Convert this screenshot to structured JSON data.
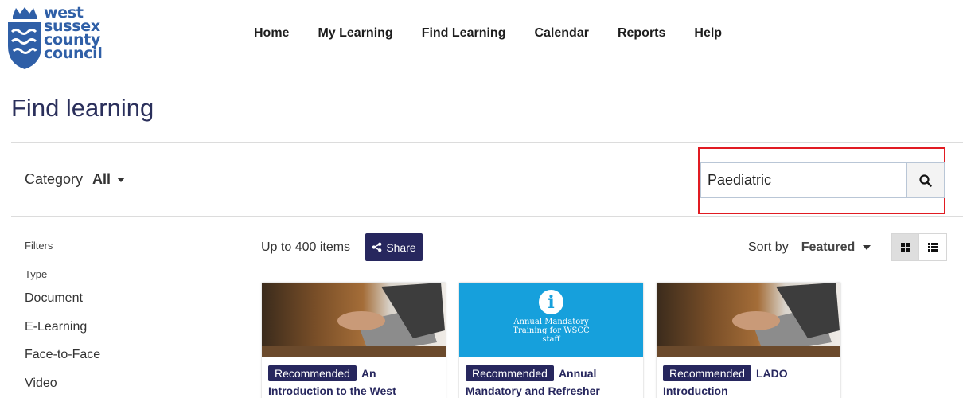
{
  "brand": {
    "logo_lines": [
      "west",
      "sussex",
      "county",
      "council"
    ],
    "color": "#2f5fa7"
  },
  "nav": {
    "items": [
      "Home",
      "My Learning",
      "Find Learning",
      "Calendar",
      "Reports",
      "Help"
    ]
  },
  "page": {
    "title": "Find learning"
  },
  "category": {
    "label": "Category",
    "value": "All"
  },
  "search": {
    "value": "Paediatric",
    "highlight_color": "#e11b22"
  },
  "filters": {
    "heading": "Filters",
    "type_heading": "Type",
    "type_items": [
      "Document",
      "E-Learning",
      "Face-to-Face",
      "Video"
    ]
  },
  "results": {
    "count_text": "Up to 400 items",
    "share_label": "Share",
    "sort_label": "Sort by",
    "sort_value": "Featured",
    "accent": "#27275e"
  },
  "cards": [
    {
      "badge": "Recommended",
      "title": "An Introduction to the West",
      "image": "laptop-photo"
    },
    {
      "badge": "Recommended",
      "title": "Annual Mandatory and Refresher",
      "image": "info-banner",
      "image_text": "Annual Mandatory Training for WSCC staff"
    },
    {
      "badge": "Recommended",
      "title": "LADO Introduction",
      "image": "laptop-photo"
    }
  ]
}
